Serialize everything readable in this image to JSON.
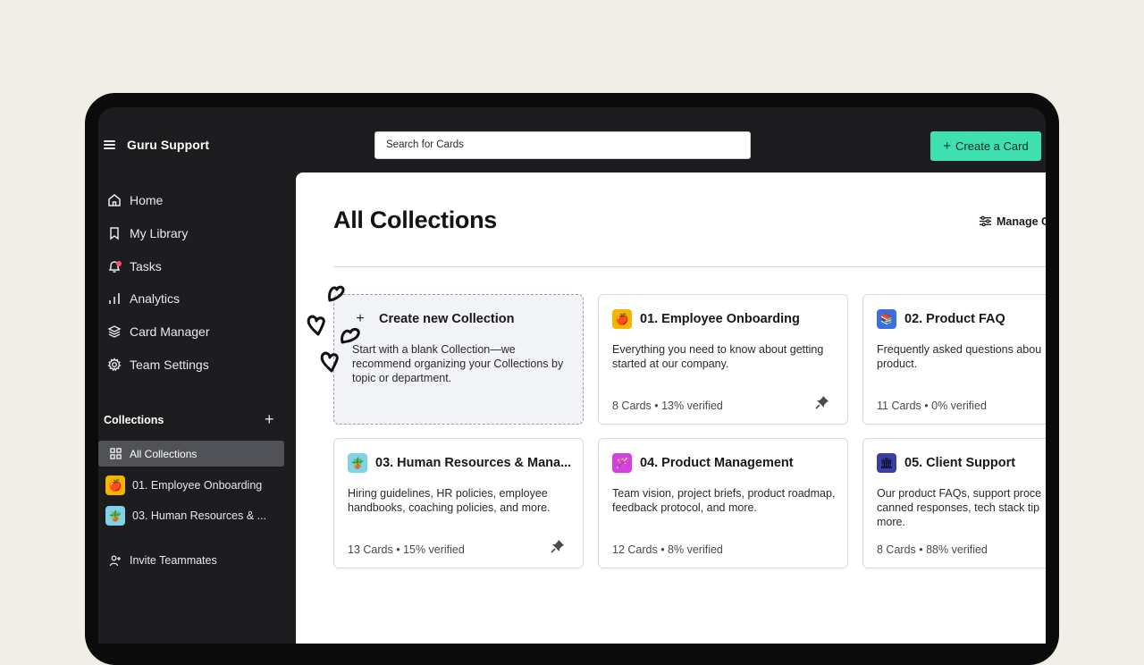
{
  "header": {
    "workspace_name": "Guru Support",
    "search_placeholder": "Search for Cards",
    "create_card_label": "Create a Card"
  },
  "sidebar": {
    "nav": [
      {
        "label": "Home",
        "icon": "home-icon"
      },
      {
        "label": "My Library",
        "icon": "bookmark-icon"
      },
      {
        "label": "Tasks",
        "icon": "bell-icon"
      },
      {
        "label": "Analytics",
        "icon": "bar-chart-icon"
      },
      {
        "label": "Card Manager",
        "icon": "layers-icon"
      },
      {
        "label": "Team Settings",
        "icon": "gear-icon"
      }
    ],
    "collections_title": "Collections",
    "all_collections_label": "All Collections",
    "collections": [
      {
        "label": "01. Employee Onboarding",
        "emoji": "🍎",
        "color": "#f4b400"
      },
      {
        "label": "03. Human Resources & ...",
        "emoji": "🪴",
        "color": "#7fd3e6"
      }
    ],
    "invite_label": "Invite Teammates"
  },
  "main": {
    "title": "All Collections",
    "manage_label": "Manage C",
    "new_collection": {
      "title": "Create new Collection",
      "description": "Start with a blank Collection—we recommend organizing your Collections by topic or department."
    },
    "cards": [
      {
        "title": "01. Employee Onboarding",
        "emoji": "🍎",
        "color": "#f4b400",
        "description": "Everything you need to know about getting started at our company.",
        "meta": "8 Cards • 13% verified",
        "pinned": true
      },
      {
        "title": "02. Product FAQ",
        "emoji": "📚",
        "color": "#3b6fe0",
        "description": "Frequently asked questions abou product.",
        "meta": "11 Cards • 0% verified",
        "pinned": false
      },
      {
        "title": "03. Human Resources & Mana...",
        "emoji": "🪴",
        "color": "#7fd3e6",
        "description": "Hiring guidelines, HR policies, employee handbooks, coaching policies, and more.",
        "meta": "13 Cards • 15% verified",
        "pinned": true
      },
      {
        "title": "04. Product Management",
        "emoji": "🪄",
        "color": "#d63fe0",
        "description": "Team vision, project briefs, product roadmap, feedback protocol, and more.",
        "meta": "12 Cards • 8% verified",
        "pinned": false
      },
      {
        "title": "05. Client Support",
        "emoji": "🏛",
        "color": "#3a3fa8",
        "description": "Our product FAQs, support proce canned responses, tech stack tip more.",
        "meta": "8 Cards • 88% verified",
        "pinned": false
      }
    ]
  }
}
